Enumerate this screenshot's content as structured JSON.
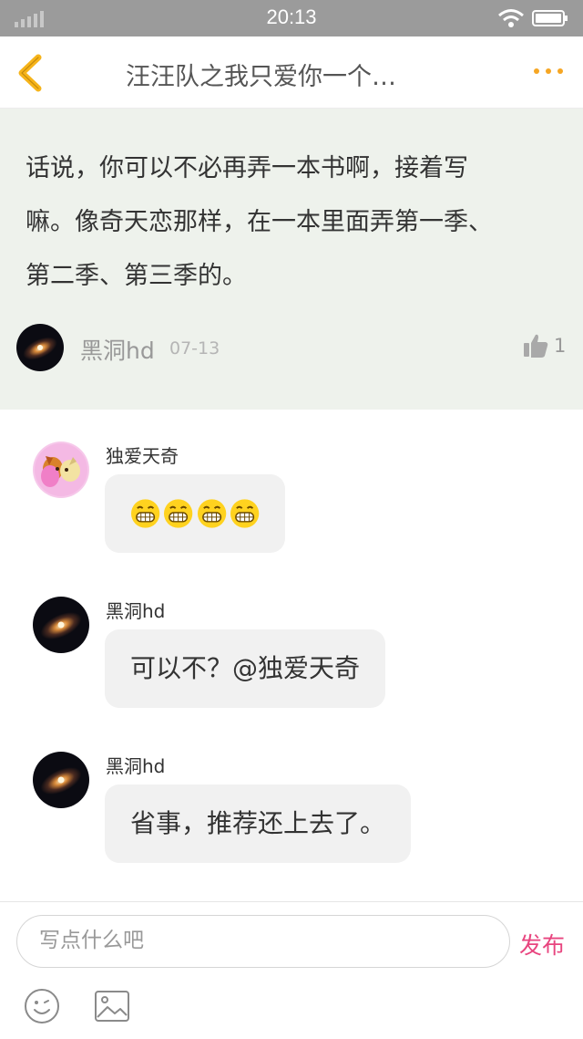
{
  "status_bar": {
    "time": "20:13"
  },
  "nav": {
    "title": "汪汪队之我只爱你一个…",
    "back_icon": "chevron-left-icon",
    "more_icon": "more-dots-icon",
    "accent_color": "#f6a623"
  },
  "post": {
    "lines": [
      "话说，你可以不必再弄一本书啊，接着写",
      "嘛。像奇天恋那样，在一本里面弄第一季、",
      "第二季、第三季的。"
    ],
    "author": "黑洞hd",
    "date": "07-13",
    "likes": "1",
    "background": "#eef2ec"
  },
  "comments": [
    {
      "author": "独爱天奇",
      "text": "",
      "emoji_count": 4,
      "emoji_name": "grinning-face-icon"
    },
    {
      "author": "黑洞hd",
      "text": "可以不？@独爱天奇"
    },
    {
      "author": "黑洞hd",
      "text": "省事，推荐还上去了。"
    }
  ],
  "input": {
    "placeholder": "写点什么吧",
    "send_label": "发布",
    "send_color": "#e8457f"
  }
}
